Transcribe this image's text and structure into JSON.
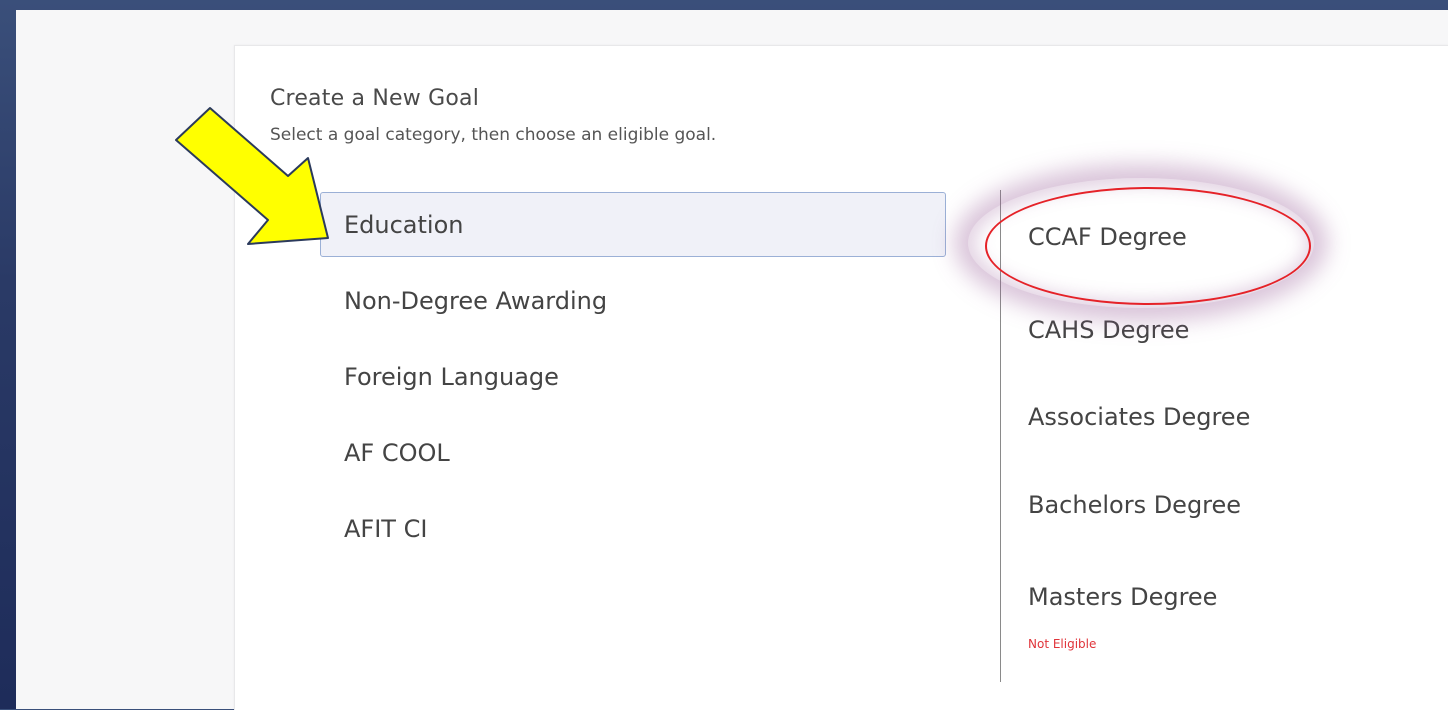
{
  "header": {
    "title": "Create a New Goal",
    "subtitle": "Select a goal category, then choose an eligible goal."
  },
  "categories": [
    {
      "label": "Education",
      "selected": true
    },
    {
      "label": "Non-Degree Awarding",
      "selected": false
    },
    {
      "label": "Foreign Language",
      "selected": false
    },
    {
      "label": "AF COOL",
      "selected": false
    },
    {
      "label": "AFIT CI",
      "selected": false
    }
  ],
  "goals": [
    {
      "label": "CCAF Degree"
    },
    {
      "label": "CAHS Degree"
    },
    {
      "label": "Associates Degree"
    },
    {
      "label": "Bachelors Degree"
    },
    {
      "label": "Masters Degree",
      "status": "Not Eligible"
    }
  ],
  "colors": {
    "accent_border": "#9bb0d6",
    "not_eligible": "#e0343a",
    "annotation_arrow": "#ffff00",
    "annotation_circle": "#e52228"
  },
  "icons": {
    "annotation_arrow": "arrow-right-down-icon",
    "annotation_circle": "ellipse-highlight-icon"
  }
}
